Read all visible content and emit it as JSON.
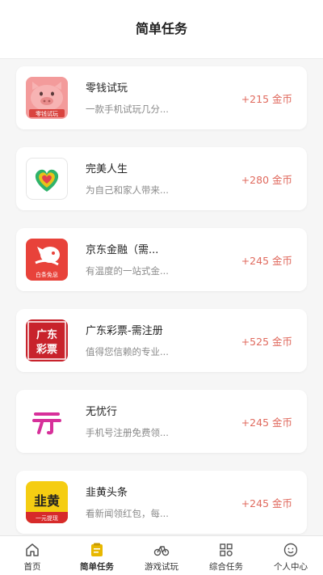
{
  "header": {
    "title": "简单任务"
  },
  "tasks": [
    {
      "name": "零钱试玩",
      "desc": "一款手机试玩几分...",
      "reward": "+215 金币",
      "icon": "piggy-bank-icon",
      "icon_text": "零钱试玩"
    },
    {
      "name": "完美人生",
      "desc": "为自己和家人带来...",
      "reward": "+280 金币",
      "icon": "heart-icon"
    },
    {
      "name": "京东金融（需...",
      "desc": "有温度的一站式金...",
      "reward": "+245 金币",
      "icon": "jd-finance-icon",
      "icon_text": "白条免息"
    },
    {
      "name": "广东彩票-需注册",
      "desc": "值得您信赖的专业...",
      "reward": "+525 金币",
      "icon": "lottery-icon",
      "icon_text": "广东彩票"
    },
    {
      "name": "无忧行",
      "desc": "手机号注册免费领...",
      "reward": "+245 金币",
      "icon": "wuyouxing-icon",
      "icon_text": "亓"
    },
    {
      "name": "韭黄头条",
      "desc": "看新闻领红包，每...",
      "reward": "+245 金币",
      "icon": "jiuhuang-icon",
      "icon_text": "韭黄",
      "icon_subtext": "一元提现"
    }
  ],
  "tabbar": [
    {
      "label": "首页",
      "icon": "home-icon",
      "active": false
    },
    {
      "label": "简单任务",
      "icon": "task-icon",
      "active": true
    },
    {
      "label": "游戏试玩",
      "icon": "game-icon",
      "active": false
    },
    {
      "label": "综合任务",
      "icon": "grid-icon",
      "active": false
    },
    {
      "label": "个人中心",
      "icon": "profile-icon",
      "active": false
    }
  ],
  "colors": {
    "reward": "#e06a5e",
    "accent": "#e8b800",
    "background": "#f6f6f6"
  }
}
